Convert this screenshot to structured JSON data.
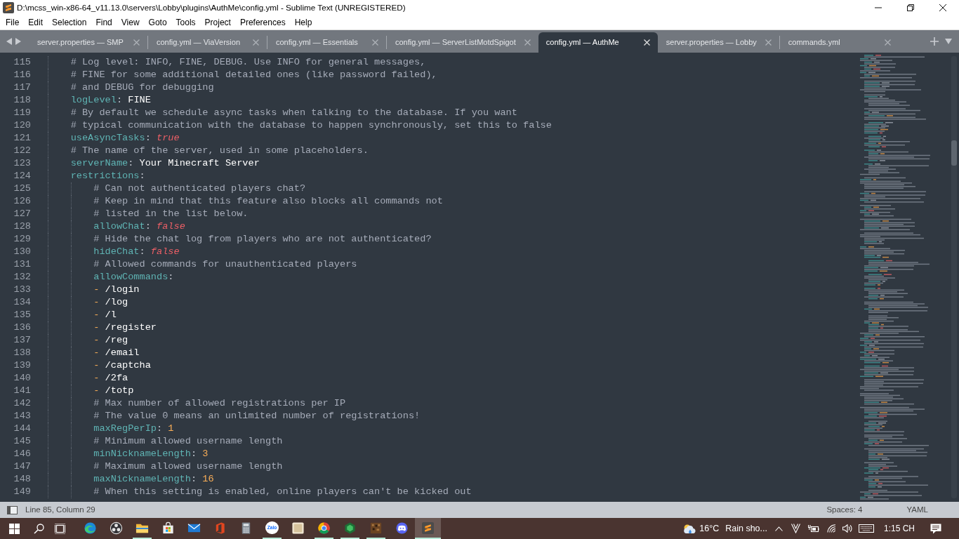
{
  "window": {
    "title": "D:\\mcss_win-x86-64_v11.13.0\\servers\\Lobby\\plugins\\AuthMe\\config.yml - Sublime Text (UNREGISTERED)"
  },
  "menu": [
    "File",
    "Edit",
    "Selection",
    "Find",
    "View",
    "Goto",
    "Tools",
    "Project",
    "Preferences",
    "Help"
  ],
  "tabs": [
    {
      "label": "server.properties — SMP",
      "selected": false
    },
    {
      "label": "config.yml — ViaVersion",
      "selected": false
    },
    {
      "label": "config.yml — Essentials",
      "selected": false
    },
    {
      "label": "config.yml — ServerListMotdSpigot",
      "selected": false
    },
    {
      "label": "config.yml — AuthMe",
      "selected": true
    },
    {
      "label": "server.properties — Lobby",
      "selected": false
    },
    {
      "label": "commands.yml",
      "selected": false
    }
  ],
  "editor": {
    "lines": [
      {
        "number": "115",
        "tokens": [
          {
            "kind": "comment",
            "text": "# Log level: INFO, FINE, DEBUG. Use INFO for general messages,"
          }
        ]
      },
      {
        "number": "116",
        "tokens": [
          {
            "kind": "comment",
            "text": "# FINE for some additional detailed ones (like password failed),"
          }
        ]
      },
      {
        "number": "117",
        "tokens": [
          {
            "kind": "comment",
            "text": "# and DEBUG for debugging"
          }
        ]
      },
      {
        "number": "118",
        "tokens": [
          {
            "kind": "key",
            "text": "logLevel"
          },
          {
            "kind": "punctuation",
            "text": ": "
          },
          {
            "kind": "string",
            "text": "FINE"
          }
        ]
      },
      {
        "number": "119",
        "tokens": [
          {
            "kind": "comment",
            "text": "# By default we schedule async tasks when talking to the database. If you want"
          }
        ]
      },
      {
        "number": "120",
        "tokens": [
          {
            "kind": "comment",
            "text": "# typical communication with the database to happen synchronously, set this to false"
          }
        ]
      },
      {
        "number": "121",
        "tokens": [
          {
            "kind": "key",
            "text": "useAsyncTasks"
          },
          {
            "kind": "punctuation",
            "text": ": "
          },
          {
            "kind": "boolean",
            "text": "true"
          }
        ]
      },
      {
        "number": "122",
        "tokens": [
          {
            "kind": "comment",
            "text": "# The name of the server, used in some placeholders."
          }
        ]
      },
      {
        "number": "123",
        "tokens": [
          {
            "kind": "key",
            "text": "serverName"
          },
          {
            "kind": "punctuation",
            "text": ": "
          },
          {
            "kind": "string",
            "text": "Your Minecraft Server"
          }
        ]
      },
      {
        "number": "124",
        "tokens": [
          {
            "kind": "key",
            "text": "restrictions"
          },
          {
            "kind": "punctuation",
            "text": ":"
          }
        ],
        "children": [
          {
            "number": "125",
            "tokens": [
              {
                "kind": "comment",
                "text": "# Can not authenticated players chat?"
              }
            ]
          },
          {
            "number": "126",
            "tokens": [
              {
                "kind": "comment",
                "text": "# Keep in mind that this feature also blocks all commands not"
              }
            ]
          },
          {
            "number": "127",
            "tokens": [
              {
                "kind": "comment",
                "text": "# listed in the list below."
              }
            ]
          },
          {
            "number": "128",
            "tokens": [
              {
                "kind": "key",
                "text": "allowChat"
              },
              {
                "kind": "punctuation",
                "text": ": "
              },
              {
                "kind": "boolean",
                "text": "false"
              }
            ]
          },
          {
            "number": "129",
            "tokens": [
              {
                "kind": "comment",
                "text": "# Hide the chat log from players who are not authenticated?"
              }
            ]
          },
          {
            "number": "130",
            "tokens": [
              {
                "kind": "key",
                "text": "hideChat"
              },
              {
                "kind": "punctuation",
                "text": ": "
              },
              {
                "kind": "boolean",
                "text": "false"
              }
            ]
          },
          {
            "number": "131",
            "tokens": [
              {
                "kind": "comment",
                "text": "# Allowed commands for unauthenticated players"
              }
            ]
          },
          {
            "number": "132",
            "tokens": [
              {
                "kind": "key",
                "text": "allowCommands"
              },
              {
                "kind": "punctuation",
                "text": ":"
              }
            ]
          },
          {
            "number": "133",
            "tokens": [
              {
                "kind": "dash",
                "text": "- "
              },
              {
                "kind": "string",
                "text": "/login"
              }
            ]
          },
          {
            "number": "134",
            "tokens": [
              {
                "kind": "dash",
                "text": "- "
              },
              {
                "kind": "string",
                "text": "/log"
              }
            ]
          },
          {
            "number": "135",
            "tokens": [
              {
                "kind": "dash",
                "text": "- "
              },
              {
                "kind": "string",
                "text": "/l"
              }
            ]
          },
          {
            "number": "136",
            "tokens": [
              {
                "kind": "dash",
                "text": "- "
              },
              {
                "kind": "string",
                "text": "/register"
              }
            ]
          },
          {
            "number": "137",
            "tokens": [
              {
                "kind": "dash",
                "text": "- "
              },
              {
                "kind": "string",
                "text": "/reg"
              }
            ]
          },
          {
            "number": "138",
            "tokens": [
              {
                "kind": "dash",
                "text": "- "
              },
              {
                "kind": "string",
                "text": "/email"
              }
            ]
          },
          {
            "number": "139",
            "tokens": [
              {
                "kind": "dash",
                "text": "- "
              },
              {
                "kind": "string",
                "text": "/captcha"
              }
            ]
          },
          {
            "number": "140",
            "tokens": [
              {
                "kind": "dash",
                "text": "- "
              },
              {
                "kind": "string",
                "text": "/2fa"
              }
            ]
          },
          {
            "number": "141",
            "tokens": [
              {
                "kind": "dash",
                "text": "- "
              },
              {
                "kind": "string",
                "text": "/totp"
              }
            ]
          },
          {
            "number": "142",
            "tokens": [
              {
                "kind": "comment",
                "text": "# Max number of allowed registrations per IP"
              }
            ]
          },
          {
            "number": "143",
            "tokens": [
              {
                "kind": "comment",
                "text": "# The value 0 means an unlimited number of registrations!"
              }
            ]
          },
          {
            "number": "144",
            "tokens": [
              {
                "kind": "key",
                "text": "maxRegPerIp"
              },
              {
                "kind": "punctuation",
                "text": ": "
              },
              {
                "kind": "number",
                "text": "1"
              }
            ]
          },
          {
            "number": "145",
            "tokens": [
              {
                "kind": "comment",
                "text": "# Minimum allowed username length"
              }
            ]
          },
          {
            "number": "146",
            "tokens": [
              {
                "kind": "key",
                "text": "minNicknameLength"
              },
              {
                "kind": "punctuation",
                "text": ": "
              },
              {
                "kind": "number",
                "text": "3"
              }
            ]
          },
          {
            "number": "147",
            "tokens": [
              {
                "kind": "comment",
                "text": "# Maximum allowed username length"
              }
            ]
          },
          {
            "number": "148",
            "tokens": [
              {
                "kind": "key",
                "text": "maxNicknameLength"
              },
              {
                "kind": "punctuation",
                "text": ": "
              },
              {
                "kind": "number",
                "text": "16"
              }
            ]
          },
          {
            "number": "149",
            "tokens": [
              {
                "kind": "comment",
                "text": "# When this setting is enabled, online players can't be kicked out"
              }
            ]
          }
        ]
      }
    ]
  },
  "status_bar": {
    "position": "Line 85, Column 29",
    "indentation": "Spaces: 4",
    "syntax": "YAML"
  },
  "taskbar": {
    "apps": [
      {
        "kind": "swirl",
        "running": false,
        "selected": false
      },
      {
        "kind": "rings",
        "running": false,
        "selected": false
      },
      {
        "kind": "folder",
        "running": true,
        "selected": false
      },
      {
        "kind": "bag",
        "running": false,
        "selected": false
      },
      {
        "kind": "envelope",
        "running": false,
        "selected": false
      },
      {
        "kind": "bracket",
        "running": false,
        "selected": false
      },
      {
        "kind": "calculator",
        "running": false,
        "selected": false
      },
      {
        "kind": "bubble",
        "label": "Zalo",
        "running": true,
        "selected": false
      },
      {
        "kind": "picture",
        "running": false,
        "selected": false
      },
      {
        "kind": "tricolor",
        "running": true,
        "selected": false
      },
      {
        "kind": "hexagon",
        "running": true,
        "selected": false
      },
      {
        "kind": "block",
        "running": true,
        "selected": false
      },
      {
        "kind": "controller",
        "running": false,
        "selected": false
      },
      {
        "kind": "stripes",
        "running": true,
        "selected": true
      }
    ],
    "weather": {
      "temperature": "16°C",
      "condition": "Rain sho..."
    },
    "clock": "1:15 CH"
  }
}
